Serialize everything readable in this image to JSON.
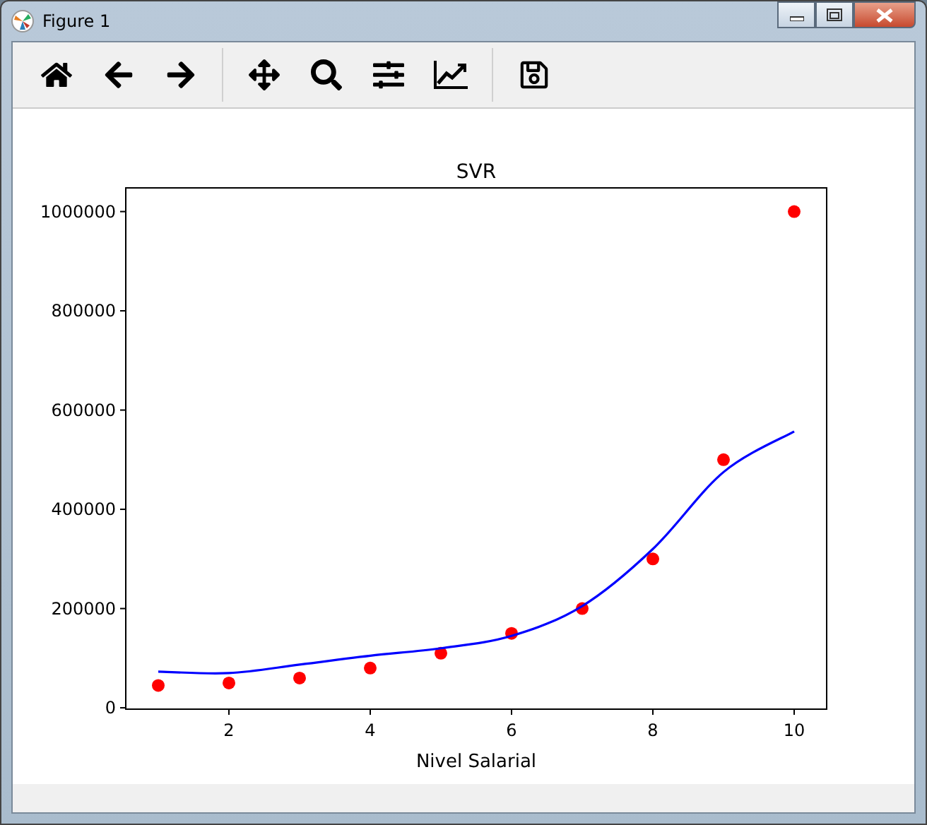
{
  "window": {
    "title": "Figure 1"
  },
  "figure": {
    "chart_data": {
      "type": "line",
      "title": "SVR",
      "xlabel": "Nivel Salarial",
      "x": [
        1,
        2,
        3,
        4,
        5,
        6,
        7,
        8,
        9,
        10
      ],
      "xlim": [
        0.54,
        10.46
      ],
      "ylim": [
        -2750,
        1047750
      ],
      "xticks": [
        2,
        4,
        6,
        8,
        10
      ],
      "yticks": [
        0,
        200000,
        400000,
        600000,
        800000,
        1000000
      ],
      "series": [
        {
          "type": "scatter",
          "color": "#ff0000",
          "values": [
            45000,
            50000,
            60000,
            80000,
            110000,
            150000,
            200000,
            300000,
            500000,
            1000000
          ]
        },
        {
          "color": "#0000ff",
          "values": [
            73000,
            70000,
            87000,
            105000,
            120000,
            145000,
            205000,
            320000,
            475000,
            557000
          ]
        }
      ]
    }
  }
}
